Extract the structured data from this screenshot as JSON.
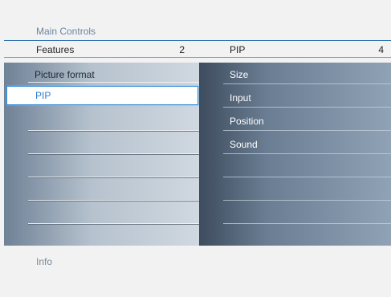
{
  "breadcrumb": "Main Controls",
  "left_header": {
    "title": "Features",
    "count": "2"
  },
  "right_header": {
    "title": "PIP",
    "count": "4"
  },
  "left_menu": {
    "items": [
      "Picture format",
      "PIP"
    ],
    "selected": "PIP"
  },
  "right_menu": {
    "items": [
      "Size",
      "Input",
      "Position",
      "Sound"
    ]
  },
  "info_label": "Info",
  "colors": {
    "accent": "#2a88d6",
    "header_line": "#2a6fb0",
    "selected_text": "#2a7cd0"
  }
}
